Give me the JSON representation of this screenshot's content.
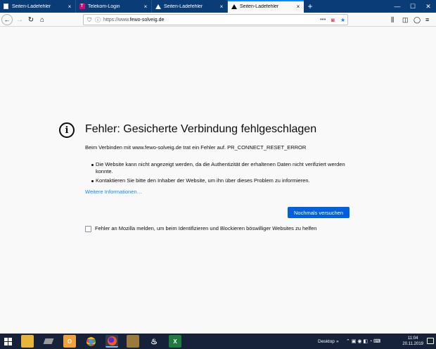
{
  "tabs": [
    {
      "label": "Seiten-Ladefehler",
      "icon": "warning-icon",
      "active": false
    },
    {
      "label": "Telekom-Login",
      "icon": "telekom-icon",
      "active": false
    },
    {
      "label": "Seiten-Ladefehler",
      "icon": "warning-icon",
      "active": false
    },
    {
      "label": "Seiten-Ladefehler",
      "icon": "warning-icon",
      "active": true
    }
  ],
  "tab_close": "×",
  "new_tab": "+",
  "window_controls": {
    "minimize": "—",
    "maximize": "☐",
    "close": "✕"
  },
  "nav": {
    "back": "←",
    "forward": "→",
    "reload": "↻",
    "home": "⌂"
  },
  "url": {
    "prefix": "https://www.",
    "host": "fewo-solveig.de"
  },
  "url_tools": {
    "more": "•••",
    "pocket": "◙",
    "bookmark": "★"
  },
  "toolbar_right": {
    "library": "⫼",
    "sidebar": "◫",
    "account": "◯",
    "menu": "≡"
  },
  "error": {
    "title": "Fehler: Gesicherte Verbindung fehlgeschlagen",
    "intro": "Beim Verbinden mit www.fewo-solveig.de trat ein Fehler auf. PR_CONNECT_RESET_ERROR",
    "bullets": [
      "Die Website kann nicht angezeigt werden, da die Authentizität der erhaltenen Daten nicht verifiziert werden konnte.",
      "Kontaktieren Sie bitte den Inhaber der Website, um ihn über dieses Problem zu informieren."
    ],
    "more_link": "Weitere Informationen…",
    "retry_button": "Nochmals versuchen",
    "report_label": "Fehler an Mozilla melden, um beim Identifizieren und Blockieren böswilliger Websites zu helfen"
  },
  "taskbar": {
    "apps": [
      {
        "name": "file-explorer-icon",
        "color": "#e8b53a"
      },
      {
        "name": "terminal-icon",
        "color": "#7a7a7a"
      },
      {
        "name": "outlook-icon",
        "color": "#f0a23b",
        "text": "O"
      },
      {
        "name": "chrome-icon",
        "color": "#4a8df0"
      },
      {
        "name": "firefox-icon",
        "color": "#f05a28",
        "active": true
      },
      {
        "name": "app-icon",
        "color": "#9a7b3c"
      },
      {
        "name": "flame-app-icon",
        "color": "#15223a",
        "text": "♨"
      },
      {
        "name": "excel-icon",
        "color": "#1f7a3c",
        "text": "X"
      }
    ],
    "desktop_label": "Desktop",
    "chevron": "»",
    "time": "11:04",
    "date": "20.11.2019"
  }
}
